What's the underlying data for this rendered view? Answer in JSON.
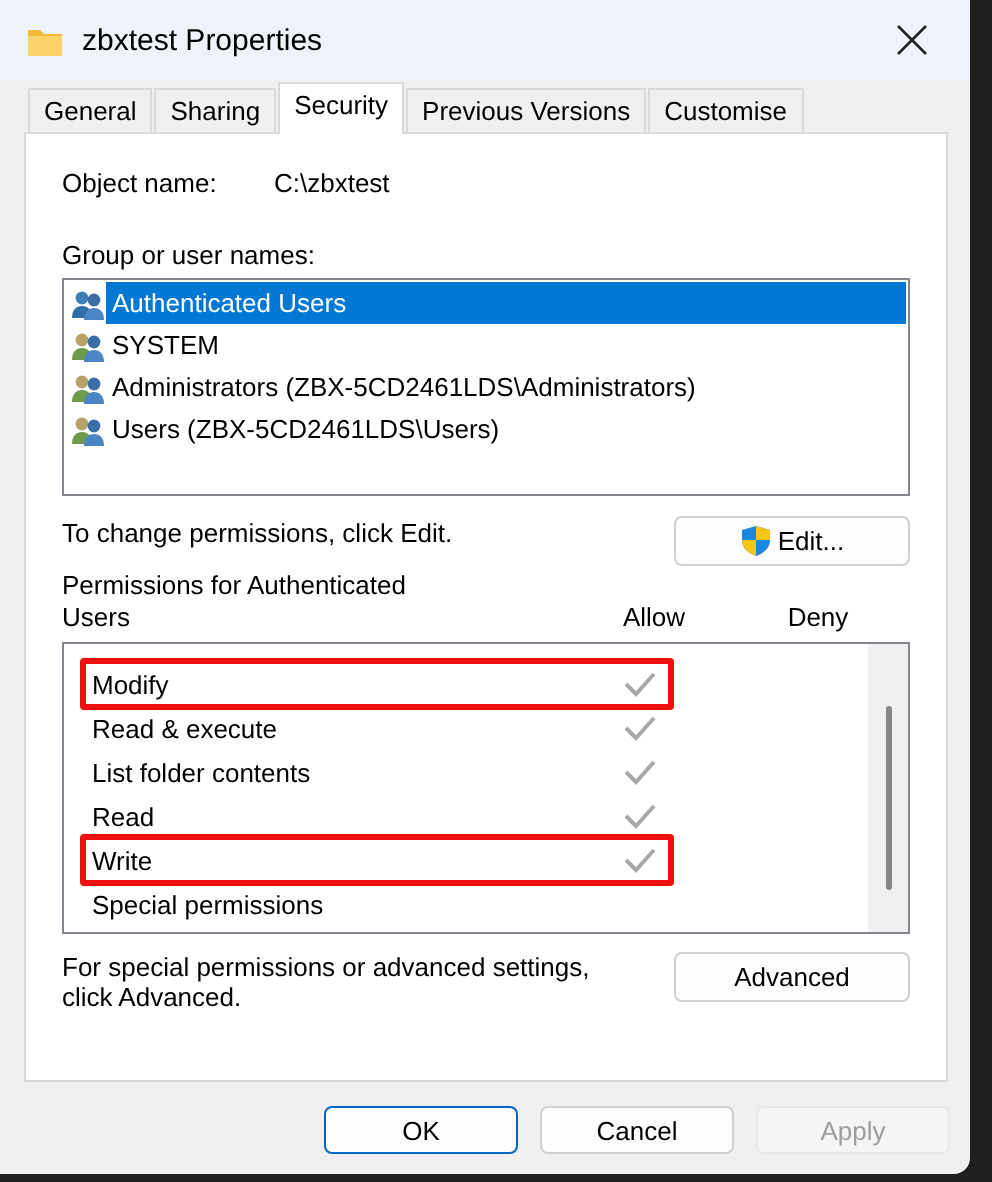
{
  "window": {
    "title": "zbxtest Properties"
  },
  "tabs": [
    {
      "label": "General",
      "selected": false
    },
    {
      "label": "Sharing",
      "selected": false
    },
    {
      "label": "Security",
      "selected": true
    },
    {
      "label": "Previous Versions",
      "selected": false
    },
    {
      "label": "Customise",
      "selected": false
    }
  ],
  "object_name": {
    "label": "Object name:",
    "value": "C:\\zbxtest"
  },
  "groups": {
    "label": "Group or user names:",
    "items": [
      {
        "name": "Authenticated Users",
        "selected": true
      },
      {
        "name": "SYSTEM",
        "selected": false
      },
      {
        "name": "Administrators (ZBX-5CD2461LDS\\Administrators)",
        "selected": false
      },
      {
        "name": "Users (ZBX-5CD2461LDS\\Users)",
        "selected": false
      }
    ]
  },
  "edit_hint": "To change permissions, click Edit.",
  "edit_button": "Edit...",
  "permissions": {
    "title": "Permissions for Authenticated Users",
    "columns": [
      "Allow",
      "Deny"
    ],
    "rows": [
      {
        "name": "Modify",
        "allow": true,
        "deny": false,
        "highlighted": true
      },
      {
        "name": "Read & execute",
        "allow": true,
        "deny": false,
        "highlighted": false
      },
      {
        "name": "List folder contents",
        "allow": true,
        "deny": false,
        "highlighted": false
      },
      {
        "name": "Read",
        "allow": true,
        "deny": false,
        "highlighted": false
      },
      {
        "name": "Write",
        "allow": true,
        "deny": false,
        "highlighted": true
      },
      {
        "name": "Special permissions",
        "allow": false,
        "deny": false,
        "highlighted": false
      }
    ]
  },
  "advanced_hint": "For special permissions or advanced settings, click Advanced.",
  "advanced_button": "Advanced",
  "buttons": [
    {
      "label": "OK",
      "default": true,
      "disabled": false
    },
    {
      "label": "Cancel",
      "default": false,
      "disabled": false
    },
    {
      "label": "Apply",
      "default": false,
      "disabled": true
    }
  ]
}
